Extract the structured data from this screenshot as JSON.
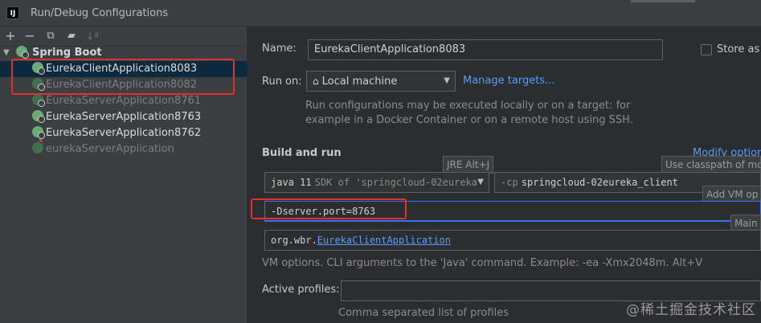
{
  "window": {
    "title": "Run/Debug Configurations",
    "logo": "IJ"
  },
  "toolbar": {
    "add": "+",
    "remove": "−",
    "copy_icon": "copy-icon",
    "folder_icon": "new-folder-icon",
    "sort_icon": "sort-icon"
  },
  "tree": {
    "group_label": "Spring Boot",
    "items": [
      {
        "label": "EurekaClientApplication8083",
        "state": "active-selected"
      },
      {
        "label": "EurekaClientApplication8082",
        "state": "dimmed"
      },
      {
        "label": "EurekaServerApplication8761",
        "state": "dimmed"
      },
      {
        "label": "EurekaServerApplication8763",
        "state": "active"
      },
      {
        "label": "EurekaServerApplication8762",
        "state": "active"
      },
      {
        "label": "eurekaServerApplication",
        "state": "error-dimmed"
      }
    ]
  },
  "form": {
    "name_label": "Name:",
    "name_value": "EurekaClientApplication8083",
    "store_label": "Store as p",
    "run_on_label": "Run on:",
    "run_on_value": "Local machine",
    "manage_targets": "Manage targets...",
    "run_on_hint_1": "Run configurations may be executed locally or on a target: for",
    "run_on_hint_2": "example in a Docker Container or on a remote host using SSH.",
    "build_and_run": "Build and run",
    "modify_options": "Modify options",
    "jre_tooltip": "JRE Alt+J",
    "jdk_version": "java 11",
    "jdk_sdk_text": "SDK of 'springcloud-02eureka",
    "classpath_flag": "-cp",
    "classpath_module": "springcloud-02eureka_client",
    "classpath_tooltip": "Use classpath of mo",
    "add_vm_tooltip": "Add VM op",
    "vm_options_value": "-Dserver.port=8763",
    "main_tooltip": "Main",
    "main_class_package": "org.wbr.",
    "main_class_name": "EurekaClientApplication",
    "vm_hint": "VM options. CLI arguments to the 'Java' command. Example: -ea -Xmx2048m. Alt+V",
    "active_profiles_label": "Active profiles:",
    "active_profiles_value": "",
    "profiles_hint": "Comma separated list of profiles"
  },
  "watermark": "@稀土掘金技术社区",
  "colors": {
    "accent": "#3574f0",
    "link": "#589df6",
    "annotation_red": "#e0302f",
    "spring_green": "#6aab73"
  }
}
